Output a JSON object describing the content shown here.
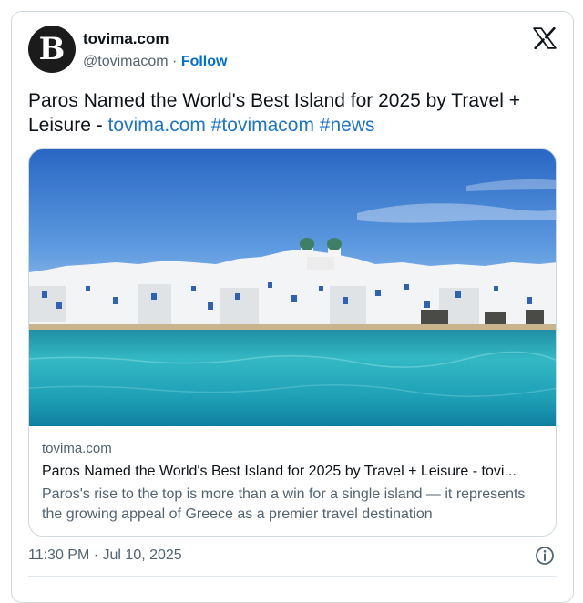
{
  "author": {
    "avatar_letter": "B",
    "name": "tovima.com",
    "handle": "@tovimacom",
    "separator": " · ",
    "follow_label": "Follow"
  },
  "brand_icon": "x-logo-icon",
  "tweet": {
    "text": "Paros Named the World's Best Island for 2025 by Travel + Leisure - ",
    "link": "tovima.com",
    "hashtag1": "#tovimacom",
    "hashtag2": "#news"
  },
  "card": {
    "domain": "tovima.com",
    "title": "Paros Named the World's Best Island for 2025 by Travel + Leisure - tovi...",
    "description": "Paros's rise to the top is more than a win for a single island — it represents the growing appeal of Greece as a premier travel destination"
  },
  "footer": {
    "timestamp": "11:30 PM · Jul 10, 2025",
    "info_icon": "info-icon"
  },
  "colors": {
    "link": "#1d75c8",
    "follow": "#006fd6",
    "secondary_text": "#536471",
    "border": "#cfd9de"
  }
}
